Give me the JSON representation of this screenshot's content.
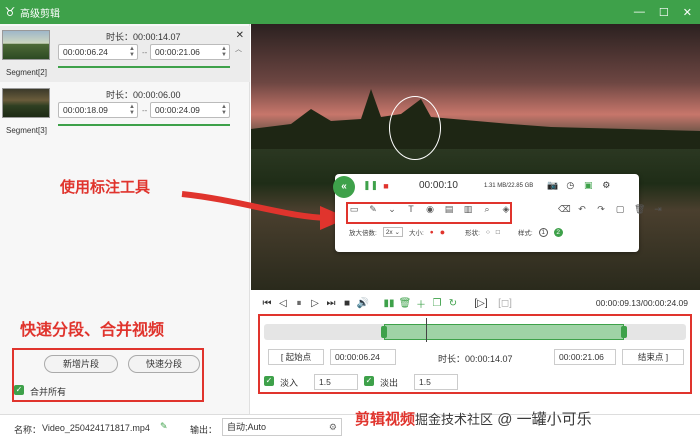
{
  "window": {
    "title": "高级剪辑",
    "minimize": "—",
    "maximize": "☐",
    "close": "✕"
  },
  "segments": [
    {
      "label": "Segment[2]",
      "duration": "时长：00:00:14.07",
      "start": "00:00:06.24",
      "end": "00:00:21.06"
    },
    {
      "label": "Segment[3]",
      "duration": "时长：00:00:06.00",
      "start": "00:00:18.09",
      "end": "00:00:24.09"
    }
  ],
  "annotations": {
    "tool": "使用标注工具",
    "split": "快速分段、合并视频"
  },
  "left_buttons": {
    "new_segment": "新增片段",
    "quick_split": "快速分段",
    "merge_all": "合并所有"
  },
  "anno_toolbar": {
    "elapsed": "00:00:10",
    "size": "1.31 MB/22.85 GB",
    "magnify_label": "放大倍数:",
    "magnify_value": "2x",
    "size_label": "大小:",
    "shape_label": "形状:",
    "style_label": "样式:",
    "style_1": "1",
    "style_2": "2"
  },
  "player": {
    "time": "00:00:09.13/00:00:24.09"
  },
  "range": {
    "start_btn": "起始点",
    "start_value": "00:00:06.24",
    "duration": "时长：00:00:14.07",
    "end_value": "00:00:21.06",
    "end_btn": "结束点",
    "fade_in": "淡入",
    "fade_in_value": "1.5",
    "fade_out": "淡出",
    "fade_out_value": "1.5"
  },
  "bottom": {
    "name_label": "名称：",
    "file_name": "Video_250424171817.mp4",
    "output_label": "输出：",
    "output_value": "自动;Auto"
  },
  "watermark": {
    "left": "剪辑视频",
    "overlap": "掘金技术社区",
    "right": "@ 一罐小可乐"
  },
  "colors": {
    "brand": "#3ea14a",
    "annotation": "#e0342d"
  }
}
